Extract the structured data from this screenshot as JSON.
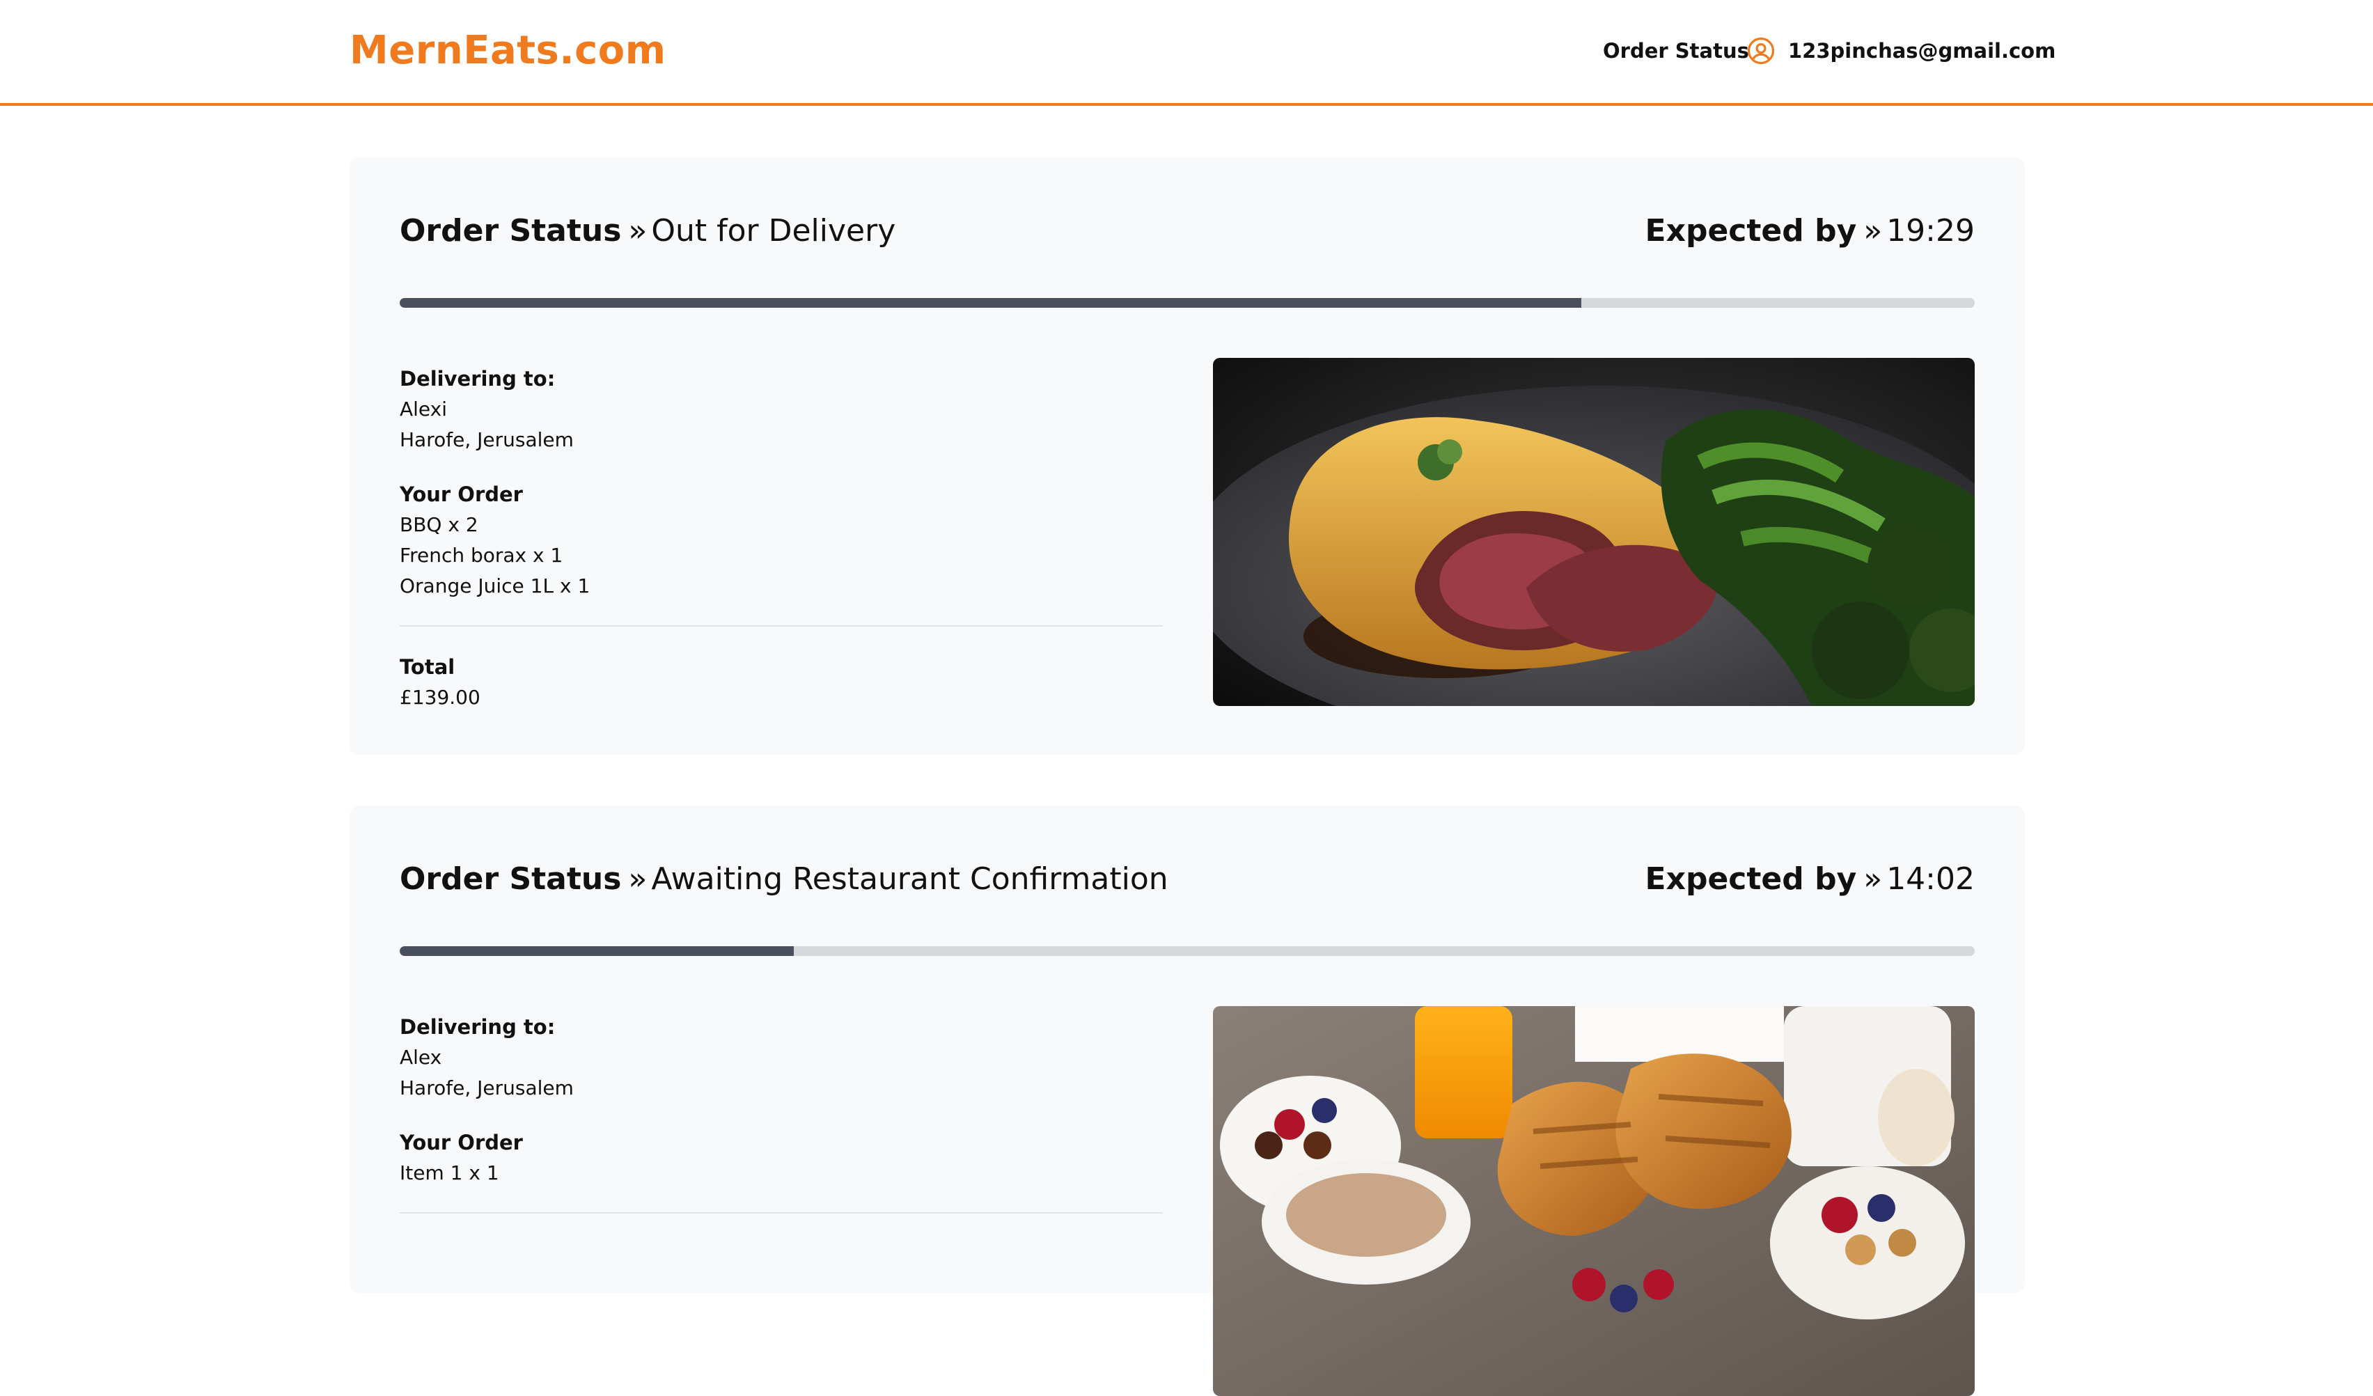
{
  "header": {
    "brand": "MernEats.com",
    "nav_order_status": "Order Status",
    "user_email": "123pinchas@gmail.com",
    "user_icon": "user-circle-icon",
    "accent_color": "#f07a1e"
  },
  "orders": [
    {
      "status_label": "Order Status",
      "status_value": "Out for Delivery",
      "expected_label": "Expected by",
      "expected_time": "19:29",
      "progress_percent": 75,
      "delivering_label": "Delivering to:",
      "name": "Alexi",
      "address": "Harofe, Jerusalem",
      "your_order_label": "Your Order",
      "items": [
        "BBQ x 2",
        "French borax x 1",
        "Orange Juice 1L x 1"
      ],
      "total_label": "Total",
      "total_value": "£139.00",
      "image": "beef-wellington-photo"
    },
    {
      "status_label": "Order Status",
      "status_value": "Awaiting Restaurant Confirmation",
      "expected_label": "Expected by",
      "expected_time": "14:02",
      "progress_percent": 25,
      "delivering_label": "Delivering to:",
      "name": "Alex",
      "address": "Harofe, Jerusalem",
      "your_order_label": "Your Order",
      "items": [
        "Item 1 x 1"
      ],
      "image": "breakfast-croissants-photo"
    }
  ],
  "icons": {
    "separator": "»"
  }
}
